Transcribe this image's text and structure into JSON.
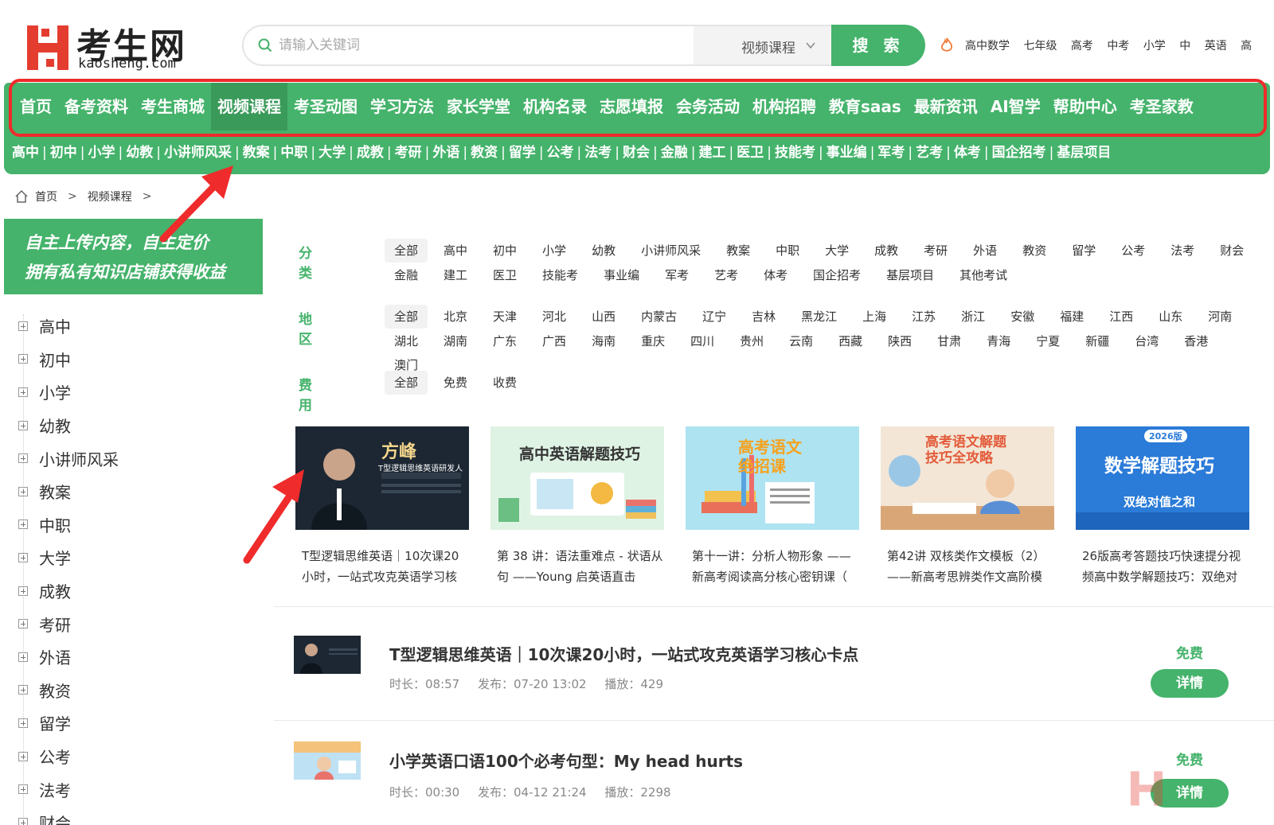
{
  "brand": {
    "logo_cn": "考生网",
    "logo_en": "kaosheng.com",
    "accent": "#45b36b",
    "annotation": "#ef2b2b"
  },
  "search": {
    "placeholder": "请输入关键词",
    "category": "视频课程",
    "button": "搜 索"
  },
  "hot_links": [
    "高中数学",
    "七年级",
    "高考",
    "中考",
    "小学",
    "中",
    "英语",
    "高"
  ],
  "main_nav": [
    "首页",
    "备考资料",
    "考生商城",
    "视频课程",
    "考圣动图",
    "学习方法",
    "家长学堂",
    "机构名录",
    "志愿填报",
    "会务活动",
    "机构招聘",
    "教育saas",
    "最新资讯",
    "AI智学",
    "帮助中心",
    "考圣家教"
  ],
  "main_nav_active": "视频课程",
  "sub_nav": [
    "高中",
    "初中",
    "小学",
    "幼教",
    "小讲师风采",
    "教案",
    "中职",
    "大学",
    "成教",
    "考研",
    "外语",
    "教资",
    "留学",
    "公考",
    "法考",
    "财会",
    "金融",
    "建工",
    "医卫",
    "技能考",
    "事业编",
    "军考",
    "艺考",
    "体考",
    "国企招考",
    "基层项目"
  ],
  "breadcrumb": [
    "首页",
    "视频课程"
  ],
  "promo": {
    "line1": "自主上传内容，自主定价",
    "line2": "拥有私有知识店铺获得收益"
  },
  "sidebar": [
    "高中",
    "初中",
    "小学",
    "幼教",
    "小讲师风采",
    "教案",
    "中职",
    "大学",
    "成教",
    "考研",
    "外语",
    "教资",
    "留学",
    "公考",
    "法考",
    "财会"
  ],
  "filters": {
    "category": {
      "title": "分类",
      "row1": [
        "全部",
        "高中",
        "初中",
        "小学",
        "幼教",
        "小讲师风采",
        "教案",
        "中职",
        "大学",
        "成教",
        "考研",
        "外语",
        "教资",
        "留学",
        "公考",
        "法考",
        "财会"
      ],
      "row2": [
        "金融",
        "建工",
        "医卫",
        "技能考",
        "事业编",
        "军考",
        "艺考",
        "体考",
        "国企招考",
        "基层项目",
        "其他考试"
      ]
    },
    "region": {
      "title": "地区",
      "row1": [
        "全部",
        "北京",
        "天津",
        "河北",
        "山西",
        "内蒙古",
        "辽宁",
        "吉林",
        "黑龙江",
        "上海",
        "江苏",
        "浙江",
        "安徽",
        "福建",
        "江西",
        "山东",
        "河南"
      ],
      "row2": [
        "湖北",
        "湖南",
        "广东",
        "广西",
        "海南",
        "重庆",
        "四川",
        "贵州",
        "云南",
        "西藏",
        "陕西",
        "甘肃",
        "青海",
        "宁夏",
        "新疆",
        "台湾",
        "香港",
        "澳门"
      ]
    },
    "fee": {
      "title": "费用",
      "row1": [
        "全部",
        "免费",
        "收费"
      ]
    }
  },
  "cards": [
    {
      "title": "T型逻辑思维英语｜10次课20小时，一站式攻克英语学习核",
      "img_text": "方峰",
      "img_sub": "T型逻辑思维英语研发人"
    },
    {
      "title": "第 38 讲：语法重难点 - 状语从句 ——Young 启英语直击",
      "img_text": "高中英语解题技巧",
      "img_sub": ""
    },
    {
      "title": "第十一讲：分析人物形象 —— 新高考阅读高分核心密钥课（",
      "img_text": "高考语文绝招课",
      "img_sub": ""
    },
    {
      "title": "第42讲 双核类作文模板（2）——新高考思辨类作文高阶模",
      "img_text": "高考语文解题技巧全攻略",
      "img_sub": ""
    },
    {
      "title": "26版高考答题技巧快速提分视频高中数学解题技巧：双绝对",
      "img_text": "数学解题技巧",
      "img_sub": "双绝对值之和",
      "img_badge": "2026版"
    }
  ],
  "list": [
    {
      "title": "T型逻辑思维英语｜10次课20小时，一站式攻克英语学习核心卡点",
      "duration": "时长：08:57",
      "published": "发布：07-20 13:02",
      "plays": "播放：429",
      "price": "免费",
      "button": "详情"
    },
    {
      "title": "小学英语口语100个必考句型：My head hurts",
      "duration": "时长：00:30",
      "published": "发布：04-12 21:24",
      "plays": "播放：2298",
      "price": "免费",
      "button": "详情"
    }
  ]
}
